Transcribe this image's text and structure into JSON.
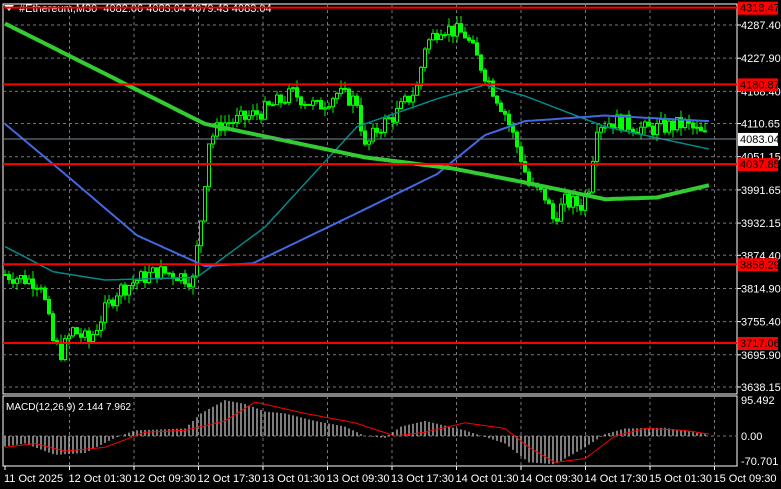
{
  "header": {
    "symbol": "#Ethereum,M30",
    "ohlc": "4082.06 4083.04 4079.43 4083.04"
  },
  "macd_label": "MACD(12,26,9) 2.144 7.962",
  "colors": {
    "bull": "#00ff00",
    "bear": "#00ff00",
    "ma_slow": "#32cd32",
    "ma_mid": "#4169e1",
    "ma_fast": "#008b8b",
    "level": "#ff0000",
    "macd_hist": "#c0c0c0",
    "macd_signal": "#ff0000"
  },
  "chart_data": {
    "type": "candlestick",
    "title": "#Ethereum,M30",
    "price_ticks": [
      "4287.40",
      "4227.90",
      "4168.40",
      "4110.65",
      "4051.15",
      "3991.65",
      "3932.15",
      "3874.40",
      "3814.90",
      "3755.40",
      "3695.90",
      "3638.15"
    ],
    "ylim": [
      3638.15,
      4287.4
    ],
    "current_price": "4083.04",
    "levels": [
      "4318.47",
      "4180.87",
      "4037.85",
      "3858.29",
      "3717.06"
    ],
    "time_labels": [
      "11 Oct 2025",
      "12 Oct 01:30",
      "12 Oct 09:30",
      "12 Oct 17:30",
      "13 Oct 01:30",
      "13 Oct 09:30",
      "13 Oct 17:30",
      "14 Oct 01:30",
      "14 Oct 09:30",
      "14 Oct 17:30",
      "15 Oct 01:30",
      "15 Oct 09:30"
    ],
    "bars": 176,
    "price_path": [
      [
        0,
        3840
      ],
      [
        9,
        3825
      ],
      [
        12,
        3720
      ],
      [
        14,
        3700
      ],
      [
        17,
        3740
      ],
      [
        21,
        3720
      ],
      [
        25,
        3775
      ],
      [
        28,
        3810
      ],
      [
        33,
        3830
      ],
      [
        38,
        3845
      ],
      [
        43,
        3840
      ],
      [
        47,
        3830
      ],
      [
        49,
        3940
      ],
      [
        51,
        4080
      ],
      [
        54,
        4110
      ],
      [
        60,
        4120
      ],
      [
        65,
        4135
      ],
      [
        72,
        4165
      ],
      [
        78,
        4140
      ],
      [
        83,
        4165
      ],
      [
        88,
        4150
      ],
      [
        90,
        4065
      ],
      [
        93,
        4100
      ],
      [
        98,
        4130
      ],
      [
        103,
        4175
      ],
      [
        105,
        4250
      ],
      [
        109,
        4285
      ],
      [
        115,
        4270
      ],
      [
        120,
        4200
      ],
      [
        125,
        4130
      ],
      [
        129,
        4050
      ],
      [
        131,
        4000
      ],
      [
        135,
        3980
      ],
      [
        137,
        3940
      ],
      [
        140,
        3970
      ],
      [
        144,
        3965
      ],
      [
        146,
        4000
      ],
      [
        148,
        4110
      ],
      [
        153,
        4115
      ],
      [
        160,
        4100
      ],
      [
        170,
        4110
      ],
      [
        176,
        4083
      ]
    ],
    "ma_slow": [
      [
        0,
        4290
      ],
      [
        50,
        4110
      ],
      [
        90,
        4050
      ],
      [
        112,
        4030
      ],
      [
        130,
        4005
      ],
      [
        150,
        3975
      ],
      [
        163,
        3978
      ],
      [
        176,
        4000
      ]
    ],
    "ma_mid": [
      [
        0,
        4110
      ],
      [
        15,
        4020
      ],
      [
        33,
        3910
      ],
      [
        50,
        3855
      ],
      [
        62,
        3860
      ],
      [
        88,
        3950
      ],
      [
        108,
        4020
      ],
      [
        120,
        4090
      ],
      [
        130,
        4115
      ],
      [
        150,
        4125
      ],
      [
        176,
        4115
      ]
    ],
    "ma_fast": [
      [
        0,
        3890
      ],
      [
        12,
        3845
      ],
      [
        25,
        3830
      ],
      [
        48,
        3835
      ],
      [
        65,
        3925
      ],
      [
        88,
        4105
      ],
      [
        108,
        4155
      ],
      [
        120,
        4180
      ],
      [
        130,
        4160
      ],
      [
        150,
        4105
      ],
      [
        163,
        4085
      ],
      [
        176,
        4065
      ]
    ],
    "macd": {
      "ylim": [
        -70.701,
        95.492
      ],
      "ticks": [
        "95.492",
        "0.00",
        "-70.701"
      ],
      "hist": [
        [
          0,
          -28
        ],
        [
          10,
          -20
        ],
        [
          25,
          -50
        ],
        [
          40,
          -45
        ],
        [
          55,
          -5
        ],
        [
          65,
          15
        ],
        [
          90,
          20
        ],
        [
          98,
          60
        ],
        [
          110,
          95
        ],
        [
          120,
          85
        ],
        [
          130,
          65
        ],
        [
          140,
          60
        ],
        [
          155,
          40
        ],
        [
          170,
          25
        ],
        [
          180,
          0
        ],
        [
          190,
          -5
        ],
        [
          198,
          25
        ],
        [
          210,
          40
        ],
        [
          230,
          15
        ],
        [
          250,
          -20
        ],
        [
          262,
          -70
        ],
        [
          275,
          -75
        ],
        [
          290,
          -30
        ],
        [
          300,
          5
        ],
        [
          310,
          20
        ],
        [
          330,
          22
        ],
        [
          350,
          5
        ]
      ],
      "signal": [
        [
          0,
          -30
        ],
        [
          15,
          -20
        ],
        [
          30,
          -40
        ],
        [
          50,
          -30
        ],
        [
          70,
          10
        ],
        [
          90,
          15
        ],
        [
          110,
          40
        ],
        [
          125,
          90
        ],
        [
          150,
          60
        ],
        [
          175,
          35
        ],
        [
          195,
          0
        ],
        [
          210,
          10
        ],
        [
          230,
          35
        ],
        [
          250,
          20
        ],
        [
          262,
          -30
        ],
        [
          275,
          -70
        ],
        [
          290,
          -60
        ],
        [
          305,
          0
        ],
        [
          320,
          20
        ],
        [
          340,
          15
        ],
        [
          352,
          5
        ]
      ]
    }
  }
}
